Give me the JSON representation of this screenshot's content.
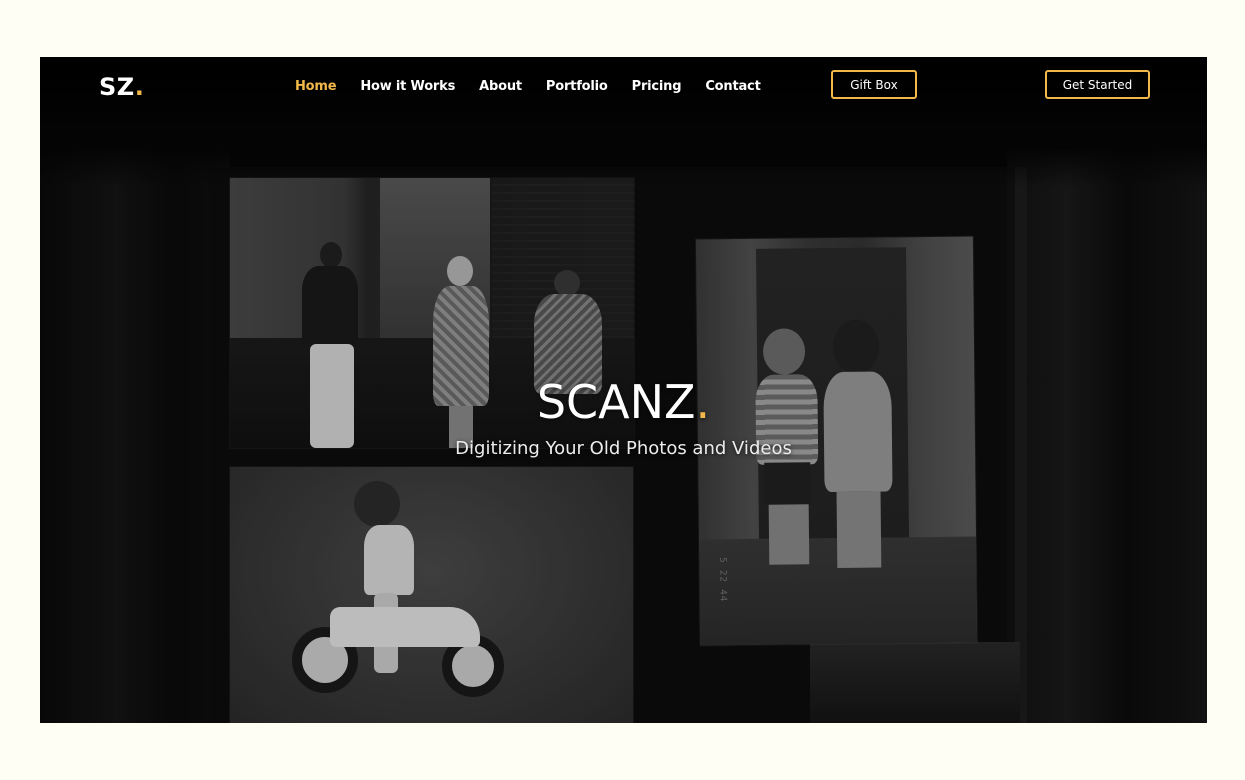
{
  "nav": {
    "logo_text": "SZ",
    "logo_dot": ".",
    "links": [
      {
        "label": "Home",
        "active": true
      },
      {
        "label": "How it Works",
        "active": false
      },
      {
        "label": "About",
        "active": false
      },
      {
        "label": "Portfolio",
        "active": false
      },
      {
        "label": "Pricing",
        "active": false
      },
      {
        "label": "Contact",
        "active": false
      }
    ],
    "gift_box_label": "Gift Box",
    "get_started_label": "Get Started"
  },
  "hero": {
    "title": "SCANZ",
    "title_dot": ".",
    "subtitle": "Digitizing Your Old Photos and Videos",
    "photo_stamp": "5 22 44"
  },
  "colors": {
    "accent": "#f2b94a",
    "page_background": "#fffef5",
    "hero_background": "#050505",
    "text": "#ffffff"
  }
}
